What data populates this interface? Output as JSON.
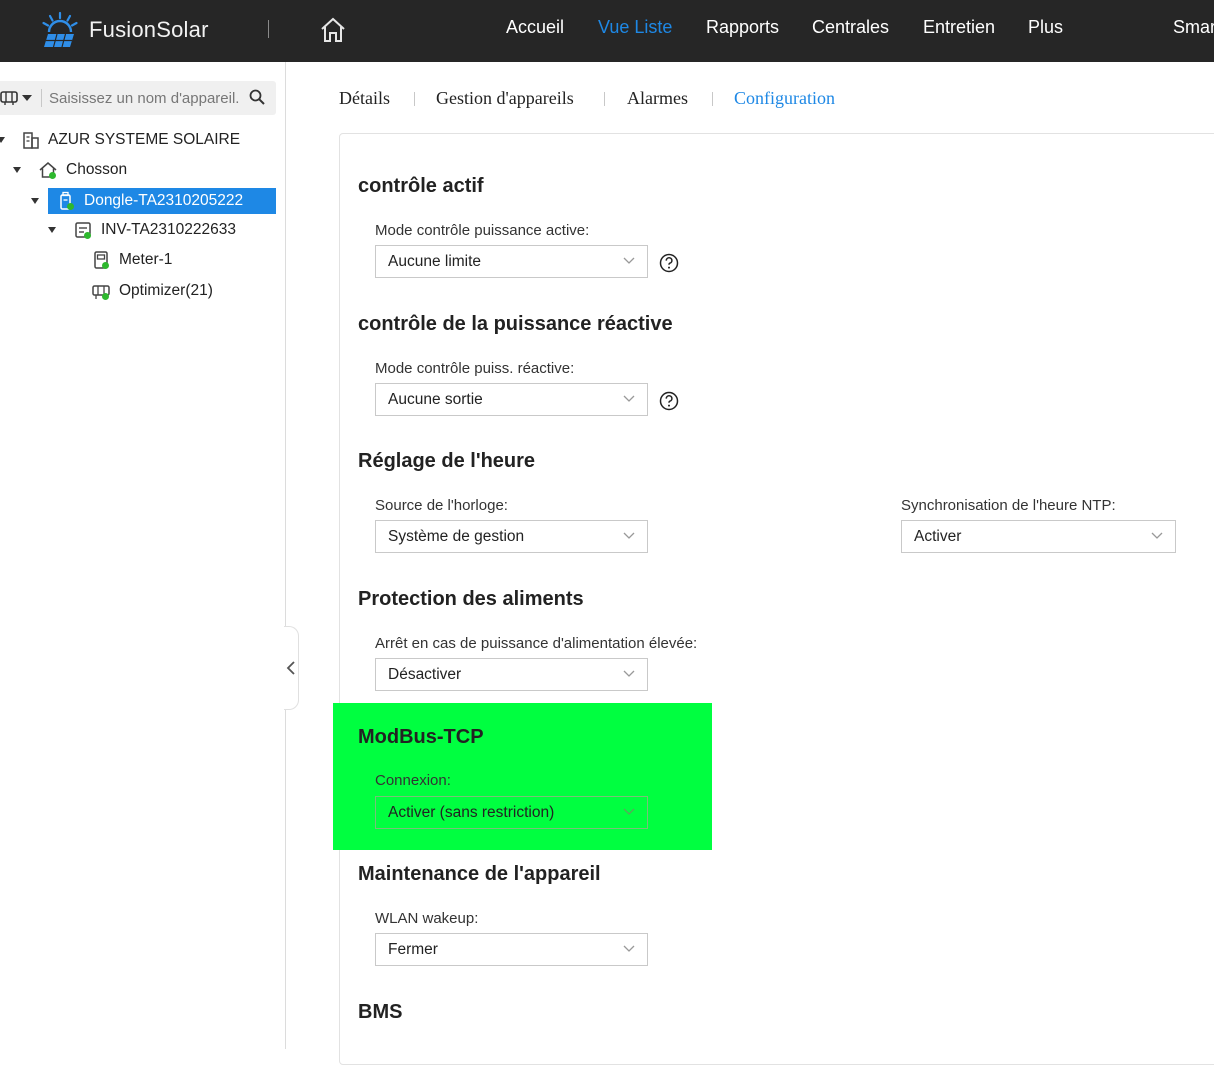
{
  "header": {
    "brand": "FusionSolar",
    "nav": [
      {
        "label": "Accueil",
        "active": false
      },
      {
        "label": "Vue Liste",
        "active": true
      },
      {
        "label": "Rapports",
        "active": false
      },
      {
        "label": "Centrales",
        "active": false
      },
      {
        "label": "Entretien",
        "active": false
      },
      {
        "label": "Plus",
        "active": false
      },
      {
        "label": "Smar",
        "active": false
      }
    ],
    "accent": "#1e88e5"
  },
  "sidebar": {
    "search_placeholder": "Saisissez un nom d'appareil.",
    "tree": [
      {
        "label": "AZUR SYSTEME SOLAIRE",
        "icon": "building-icon"
      },
      {
        "label": "Chosson",
        "icon": "home-plant-icon"
      },
      {
        "label": "Dongle-TA2310205222",
        "icon": "dongle-icon",
        "selected": true
      },
      {
        "label": "INV-TA2310222633",
        "icon": "inverter-icon"
      },
      {
        "label": "Meter-1",
        "icon": "meter-icon"
      },
      {
        "label": "Optimizer(21)",
        "icon": "optimizer-icon"
      }
    ]
  },
  "tabs": [
    {
      "label": "Détails",
      "active": false
    },
    {
      "label": "Gestion d'appareils",
      "active": false
    },
    {
      "label": "Alarmes",
      "active": false
    },
    {
      "label": "Configuration",
      "active": true
    }
  ],
  "config": {
    "active_control": {
      "title": "contrôle actif",
      "field_label": "Mode contrôle puissance active:",
      "value": "Aucune limite"
    },
    "reactive_control": {
      "title": "contrôle de la puissance réactive",
      "field_label": "Mode contrôle puiss. réactive:",
      "value": "Aucune sortie"
    },
    "time_setting": {
      "title": "Réglage de l'heure",
      "clock_label": "Source de l'horloge:",
      "clock_value": "Système de gestion",
      "ntp_label": "Synchronisation de l'heure NTP:",
      "ntp_value": "Activer"
    },
    "feed_protection": {
      "title": "Protection des aliments",
      "field_label": "Arrêt en cas de puissance d'alimentation élevée:",
      "value": "Désactiver"
    },
    "modbus": {
      "title": "ModBus-TCP",
      "field_label": "Connexion:",
      "value": "Activer (sans restriction)",
      "highlight_color": "#00ff40"
    },
    "maintenance": {
      "title": "Maintenance de l'appareil",
      "field_label": "WLAN wakeup:",
      "value": "Fermer"
    },
    "bms": {
      "title": "BMS"
    }
  }
}
